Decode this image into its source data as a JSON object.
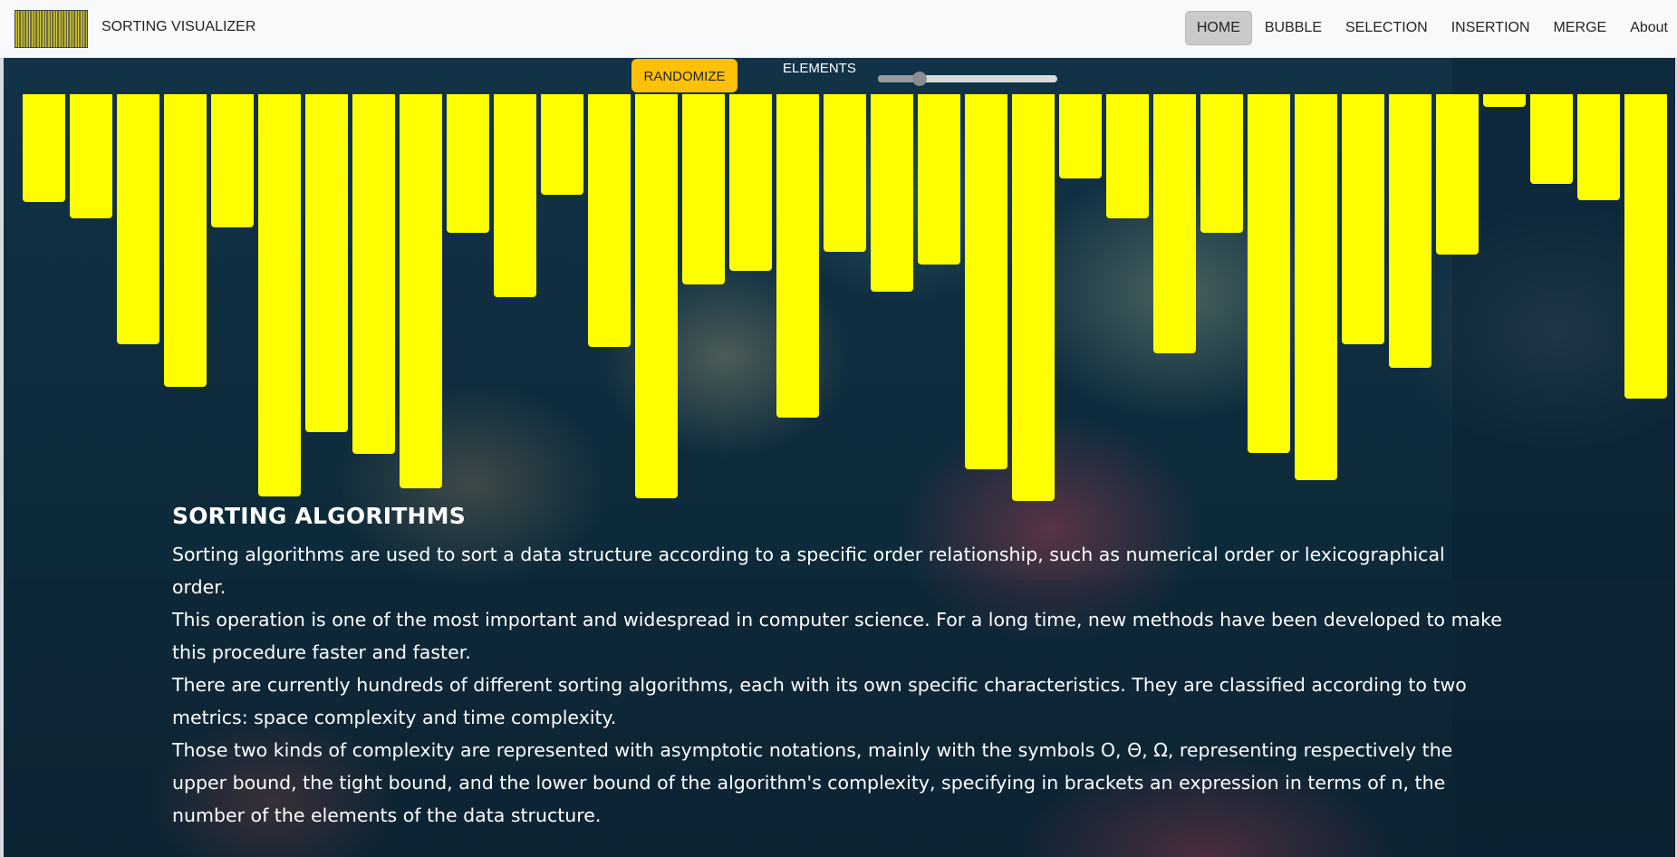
{
  "navbar": {
    "brand": "SORTING VISUALIZER",
    "links": [
      {
        "label": "HOME",
        "active": true
      },
      {
        "label": "BUBBLE",
        "active": false
      },
      {
        "label": "SELECTION",
        "active": false
      },
      {
        "label": "INSERTION",
        "active": false
      },
      {
        "label": "MERGE",
        "active": false
      },
      {
        "label": "About",
        "active": false
      }
    ]
  },
  "controls": {
    "randomize_label": "RANDOMIZE",
    "elements_label": "ELEMENTS",
    "slider_fraction": 0.23
  },
  "colors": {
    "bar": "#ffff00",
    "randomize_button": "#ffc107",
    "navbar_background": "#f8f9fa"
  },
  "array_values": [
    119,
    137,
    276,
    323,
    147,
    444,
    373,
    397,
    435,
    153,
    224,
    111,
    279,
    446,
    210,
    195,
    357,
    174,
    218,
    188,
    414,
    449,
    93,
    137,
    286,
    153,
    396,
    426,
    276,
    302,
    177,
    14,
    99,
    117,
    336
  ],
  "content": {
    "heading": "SORTING ALGORITHMS",
    "paragraphs": [
      "Sorting algorithms are used to sort a data structure according to a specific order relationship, such as numerical order or lexicographical order.",
      "This operation is one of the most important and widespread in computer science. For a long time, new methods have been developed to make this procedure faster and faster.",
      "There are currently hundreds of different sorting algorithms, each with its own specific characteristics. They are classified according to two metrics: space complexity and time complexity.",
      "Those two kinds of complexity are represented with asymptotic notations, mainly with the symbols O, Θ, Ω, representing respectively the upper bound, the tight bound, and the lower bound of the algorithm's complexity, specifying in brackets an expression in terms of n, the number of the elements of the data structure."
    ]
  }
}
